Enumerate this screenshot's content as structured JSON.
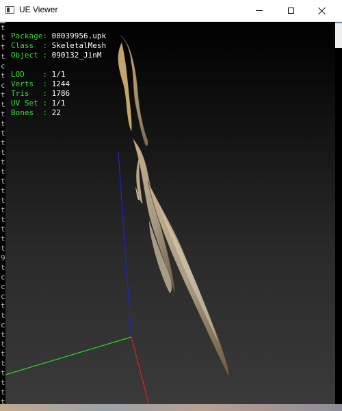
{
  "window": {
    "title": "UE Viewer"
  },
  "info_panel": {
    "rows_top": [
      {
        "label": "Package: ",
        "value": "00039956.upk"
      },
      {
        "label": "Class  : ",
        "value": "SkeletalMesh"
      },
      {
        "label": "Object : ",
        "value": "090132_JinM"
      }
    ],
    "rows_bottom": [
      {
        "label": "LOD    : ",
        "value": "1/1"
      },
      {
        "label": "Verts  : ",
        "value": "1244"
      },
      {
        "label": "Tris   : ",
        "value": "1786"
      },
      {
        "label": "UV Set : ",
        "value": "1/1"
      },
      {
        "label": "Bones  : ",
        "value": "22"
      }
    ]
  },
  "background_console": {
    "left_chars": [
      "t",
      "t",
      "t",
      "t",
      "c",
      "t",
      "c",
      "t",
      "t",
      "t",
      "t",
      "t",
      "t",
      "t",
      "t",
      "t",
      "t",
      "t",
      "t",
      "t",
      "t",
      "t",
      "t",
      "t",
      "9",
      "t",
      "c",
      "c",
      "c",
      "t",
      "t",
      "c",
      "t",
      "t",
      "t",
      "t",
      "t",
      "t",
      "t",
      "t"
    ],
    "right_fragments": [
      "",
      "",
      "",
      "",
      "",
      "",
      "",
      "",
      "",
      "",
      "",
      "",
      "",
      "",
      "",
      "",
      "",
      "",
      "",
      "",
      "",
      ""
    ]
  },
  "colors": {
    "info_label": "#33dd33",
    "info_value": "#ffffff",
    "axis_x": "#dd2222",
    "axis_y": "#22dd22",
    "axis_z": "#2222cc"
  }
}
